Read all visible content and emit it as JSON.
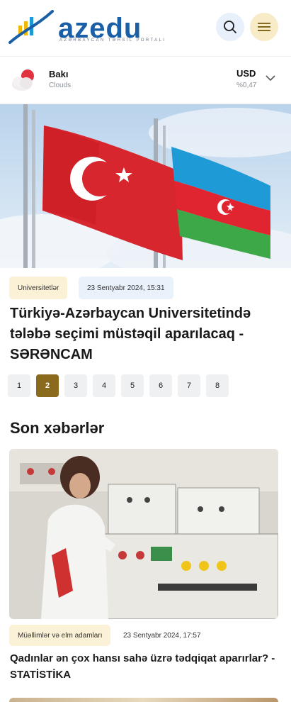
{
  "header": {
    "logo_text": "azedu",
    "logo_tagline": "AZƏRBAYCAN TƏHSİL PORTALI",
    "search_icon": "search-icon",
    "menu_icon": "menu-icon"
  },
  "weather": {
    "city": "Bakı",
    "condition": "Clouds",
    "icon": "cloud-sun-icon"
  },
  "currency": {
    "code": "USD",
    "change": "%0,47",
    "icon": "chevron-down-icon"
  },
  "featured": {
    "category": "Universitetlər",
    "date": "23 Sentyabr 2024, 15:31",
    "title": "Türkiyə-Azərbaycan Universitetində tələbə seçimi müstəqil aparılacaq - SƏRƏNCAM",
    "pages": [
      "1",
      "2",
      "3",
      "4",
      "5",
      "6",
      "7",
      "8"
    ],
    "active_page": "2"
  },
  "latest": {
    "section_title": "Son xəbərlər",
    "items": [
      {
        "category": "Müəllimlər və elm adamları",
        "date": "23 Sentyabr 2024, 17:57",
        "title": "Qadınlar ən çox hansı sahə üzrə tədqiqat aparırlar? - STATİSTİKA"
      }
    ]
  },
  "colors": {
    "brand_blue": "#1b5fa6",
    "accent_gold": "#8a6a1c",
    "tag_cream": "#fbf1d6",
    "tag_blue": "#e9f2fb"
  }
}
